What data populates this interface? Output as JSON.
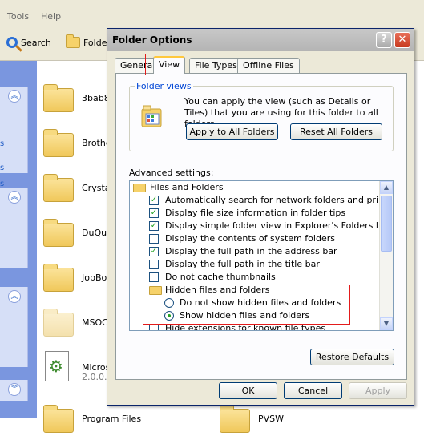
{
  "explorer": {
    "menu": [
      "Tools",
      "Help"
    ],
    "toolbar": {
      "search_label": "Search",
      "folders_label": "Folde"
    },
    "files": [
      "3bab8",
      "Brothe",
      "Crysta",
      "DuQue",
      "JobBo",
      "MSOC",
      "Micros",
      "2.0.0.",
      "Program Files",
      "PVSW"
    ]
  },
  "dialog": {
    "title": "Folder Options",
    "help_glyph": "?",
    "close_glyph": "✕",
    "tabs": [
      "General",
      "View",
      "File Types",
      "Offline Files"
    ],
    "active_tab": "View",
    "folder_views": {
      "legend": "Folder views",
      "description": "You can apply the view (such as Details or Tiles) that you are using for this folder to all folders.",
      "apply_all": "Apply to All Folders",
      "reset_all": "Reset All Folders"
    },
    "advanced_label": "Advanced settings:",
    "settings": [
      {
        "kind": "folder",
        "label": "Files and Folders"
      },
      {
        "kind": "checkbox",
        "label": "Automatically search for network folders and printers",
        "checked": true
      },
      {
        "kind": "checkbox",
        "label": "Display file size information in folder tips",
        "checked": true
      },
      {
        "kind": "checkbox",
        "label": "Display simple folder view in Explorer's Folders list",
        "checked": true
      },
      {
        "kind": "checkbox",
        "label": "Display the contents of system folders",
        "checked": false
      },
      {
        "kind": "checkbox",
        "label": "Display the full path in the address bar",
        "checked": true
      },
      {
        "kind": "checkbox",
        "label": "Display the full path in the title bar",
        "checked": false
      },
      {
        "kind": "checkbox",
        "label": "Do not cache thumbnails",
        "checked": false
      },
      {
        "kind": "folder",
        "label": "Hidden files and folders"
      },
      {
        "kind": "radio",
        "label": "Do not show hidden files and folders",
        "checked": false
      },
      {
        "kind": "radio",
        "label": "Show hidden files and folders",
        "checked": true
      },
      {
        "kind": "checkbox",
        "label": "Hide extensions for known file types",
        "checked": false
      }
    ],
    "restore_defaults": "Restore Defaults",
    "ok": "OK",
    "cancel": "Cancel",
    "apply": "Apply"
  },
  "colors": {
    "highlight_box": "#e31b1b",
    "check_green": "#21a121",
    "legend_blue": "#0046d5"
  }
}
